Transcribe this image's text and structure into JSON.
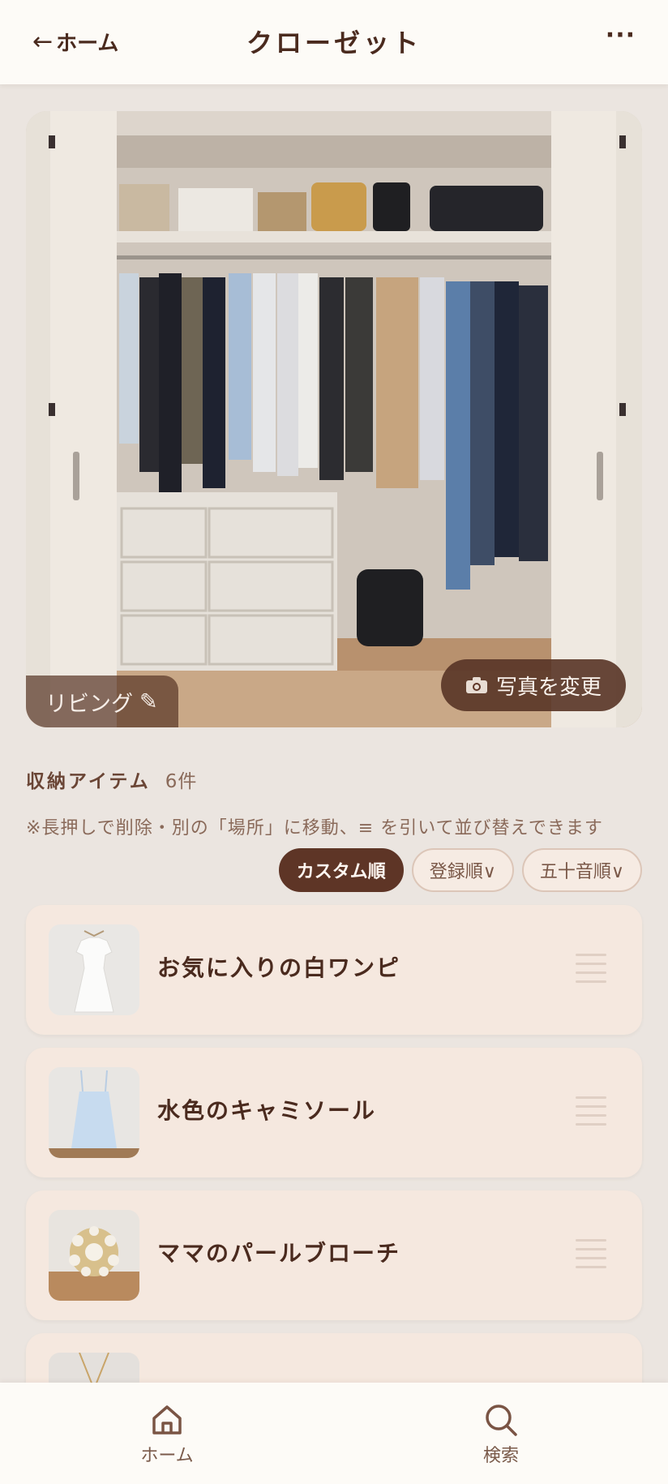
{
  "header": {
    "back_label": "ホーム",
    "title": "クローゼット",
    "more_label": "···"
  },
  "photo": {
    "location_label": "リビング",
    "change_photo_label": "写真を変更"
  },
  "items_section": {
    "title": "収納アイテム",
    "count_label": "6件",
    "hint": "※長押しで削除・別の「場所」に移動、≡ を引いて並び替えできます"
  },
  "sort_options": [
    {
      "label": "カスタム順",
      "active": true
    },
    {
      "label": "登録順∨",
      "active": false
    },
    {
      "label": "五十音順∨",
      "active": false
    }
  ],
  "items": [
    {
      "name": "お気に入りの白ワンピ",
      "thumb_icon": "white-dress-icon"
    },
    {
      "name": "水色のキャミソール",
      "thumb_icon": "camisole-icon"
    },
    {
      "name": "ママのパールブローチ",
      "thumb_icon": "brooch-icon"
    },
    {
      "name": "",
      "thumb_icon": "necklace-icon"
    }
  ],
  "bottom_nav": {
    "home_label": "ホーム",
    "search_label": "検索"
  },
  "colors": {
    "accent": "#5e3526",
    "card_bg": "#f5e8df",
    "page_bg": "#ebe5e0"
  }
}
